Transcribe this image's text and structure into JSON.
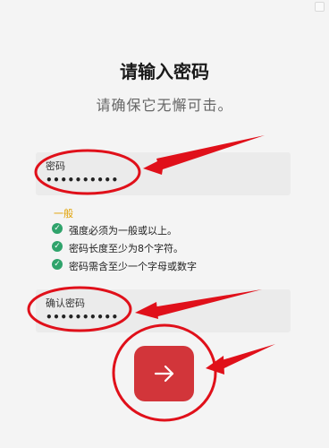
{
  "title": "请输入密码",
  "subtitle": "请确保它无懈可击。",
  "password_field": {
    "label": "密码",
    "value": "••••••••••"
  },
  "strength": {
    "label": "一般",
    "rules": [
      {
        "text": "强度必须为一般或以上。",
        "status": "check-icon"
      },
      {
        "text": "密码长度至少为8个字符。",
        "status": "check-icon"
      },
      {
        "text": "密码需含至少一个字母或数字",
        "status": "check-icon"
      }
    ]
  },
  "confirm_field": {
    "label": "确认密码",
    "value": "••••••••••"
  },
  "next_button": {
    "icon": "arrow-right-icon"
  },
  "colors": {
    "accent": "#d2353a",
    "success": "#2fa36b",
    "warning": "#e0a000",
    "annotation": "#e0101a"
  }
}
